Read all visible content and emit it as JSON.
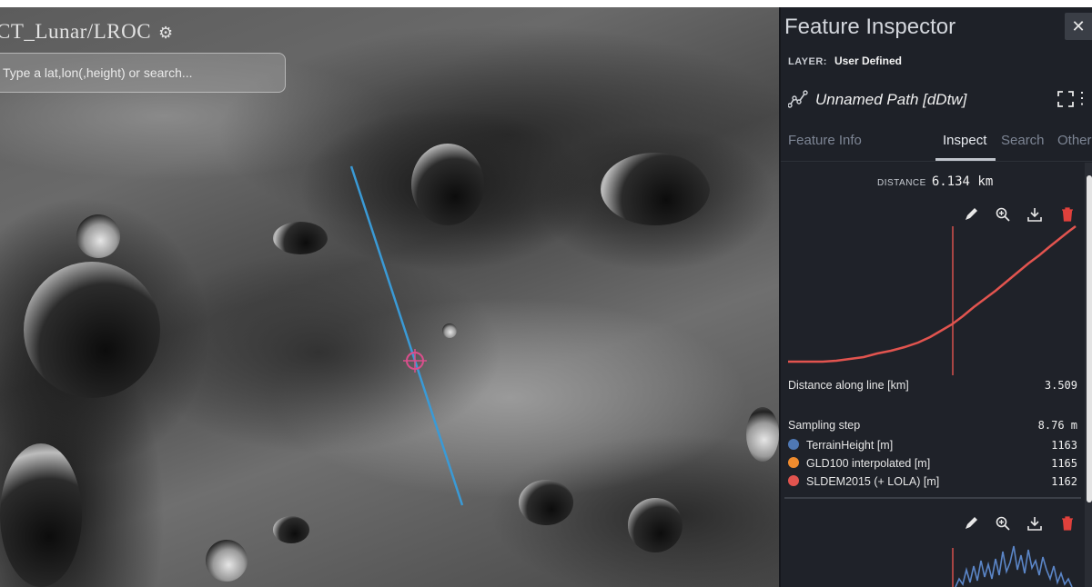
{
  "app": {
    "title": "CT_Lunar/LROC",
    "search_placeholder": "Type a lat,lon(,height) or search..."
  },
  "inspector": {
    "title": "Feature Inspector",
    "close_label": "✕",
    "layer_label": "LAYER:",
    "layer_value": "User Defined",
    "feature_name": "Unnamed Path [dDtw]",
    "tabs": [
      {
        "label": "Feature Info",
        "active": false
      },
      {
        "label": "Inspect",
        "active": true
      },
      {
        "label": "Search",
        "active": false
      },
      {
        "label": "Other",
        "active": false
      }
    ],
    "distance_label": "DISTANCE",
    "distance_value": "6.134 km",
    "tools": [
      "pencil-icon",
      "zoom-in-icon",
      "download-icon",
      "trash-icon"
    ],
    "stats": {
      "distance_along_label": "Distance along line [km]",
      "distance_along_value": "3.509",
      "sampling_step_label": "Sampling step",
      "sampling_step_value": "8.76 m",
      "series": [
        {
          "label": "TerrainHeight [m]",
          "value": "1163",
          "color": "#4f78b4"
        },
        {
          "label": "GLD100 interpolated [m]",
          "value": "1165",
          "color": "#f08c2e"
        },
        {
          "label": "SLDEM2015 (+ LOLA) [m]",
          "value": "1162",
          "color": "#e2544f"
        }
      ]
    }
  },
  "colors": {
    "panel_bg": "#1e2128",
    "path_line": "#3a9ad6",
    "profile_line": "#e2544f",
    "cursor_line": "#e2544f",
    "second_profile": "#5b86c8",
    "trash": "#e0413c",
    "target_marker": "#d94f8c"
  }
}
